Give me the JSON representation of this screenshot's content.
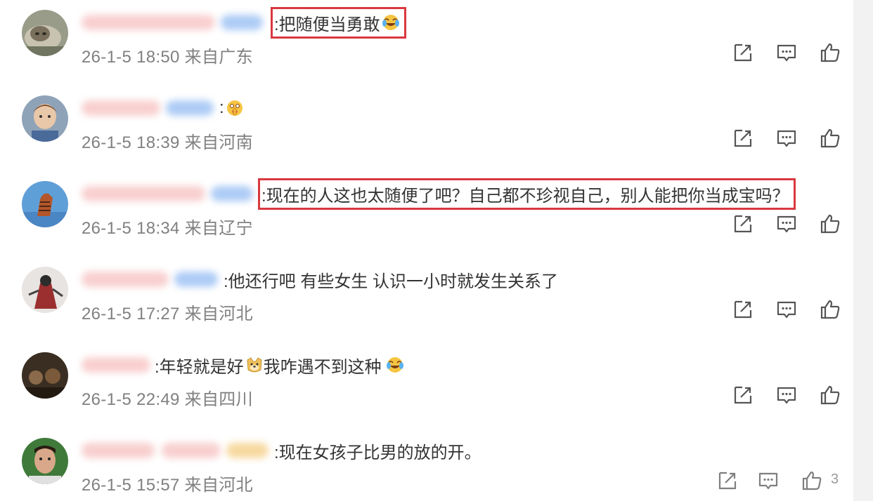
{
  "comments": [
    {
      "text": ":把随便当勇敢",
      "emoji": "laughing-crying-emoji",
      "time": "26-1-5 18:50",
      "location": "来自广东",
      "highlighted": true
    },
    {
      "text": ":",
      "emoji": "shushing-face-emoji",
      "time": "26-1-5 18:39",
      "location": "来自河南",
      "highlighted": false
    },
    {
      "text": ":现在的人这也太随便了吧？自己都不珍视自己，别人能把你当成宝吗？",
      "emoji": "",
      "time": "26-1-5 18:34",
      "location": "来自辽宁",
      "highlighted": true
    },
    {
      "text": ":他还行吧 有些女生 认识一小时就发生关系了",
      "emoji": "",
      "time": "26-1-5 17:27",
      "location": "来自河北",
      "highlighted": false
    },
    {
      "text_a": ":年轻就是好",
      "emoji_mid": "doge-emoji",
      "text_b": "我咋遇不到这种",
      "emoji": "laughing-crying-emoji",
      "time": "26-1-5 22:49",
      "location": "来自四川",
      "highlighted": false
    },
    {
      "text": ":现在女孩子比男的放的开。",
      "emoji": "",
      "time": "26-1-5 15:57",
      "location": "来自河北",
      "highlighted": false,
      "like_count": "3"
    }
  ],
  "icons": {
    "share": "share-icon",
    "reply": "comment-icon",
    "like": "thumbs-up-icon"
  },
  "colors": {
    "highlight_border": "#d9383f",
    "meta_text": "#808080",
    "body_text": "#333333"
  }
}
